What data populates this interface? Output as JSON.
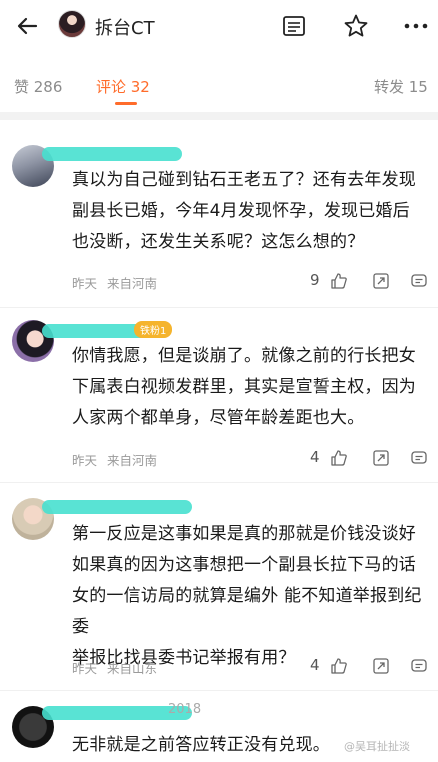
{
  "header": {
    "title": "拆台CT",
    "back_icon": "back-arrow-icon",
    "actions": [
      "list-icon",
      "star-icon",
      "more-icon"
    ]
  },
  "tabs": [
    {
      "label": "赞 286",
      "active": false
    },
    {
      "label": "评论 32",
      "active": true
    },
    {
      "label": "转发 15",
      "active": false
    }
  ],
  "comments": [
    {
      "name": "",
      "text": [
        "真以为自己碰到钻石王老五了？还有去年发现",
        "副县长已婚，今年4月发现怀孕，发现已婚后",
        "也没断，还发生关系呢？这怎么想的？"
      ],
      "time": "昨天",
      "location": "来自河南",
      "likes": "9"
    },
    {
      "name": "",
      "badge": "铁粉1",
      "text": [
        "你情我愿，但是谈崩了。就像之前的行长把女",
        "下属表白视频发群里，其实是宣誓主权，因为",
        "人家两个都单身，尽管年龄差距也大。"
      ],
      "time": "昨天",
      "location": "来自河南",
      "likes": "4"
    },
    {
      "name": "",
      "text": [
        "第一反应是这事如果是真的那就是价钱没谈好",
        "如果真的因为这事想把一个副县长拉下马的话",
        "女的一信访局的就算是编外 能不知道举报到纪委",
        "举报比找县委书记举报有用？"
      ],
      "time": "昨天",
      "location": "来自山东",
      "likes": "4"
    },
    {
      "name": "2018",
      "text": [
        "无非就是之前答应转正没有兑现。"
      ]
    }
  ],
  "watermark": "@吴耳扯扯淡",
  "colors": {
    "accent": "#ff6c2b",
    "redaction": "#47e0cf",
    "badge": "#f5b42d"
  }
}
